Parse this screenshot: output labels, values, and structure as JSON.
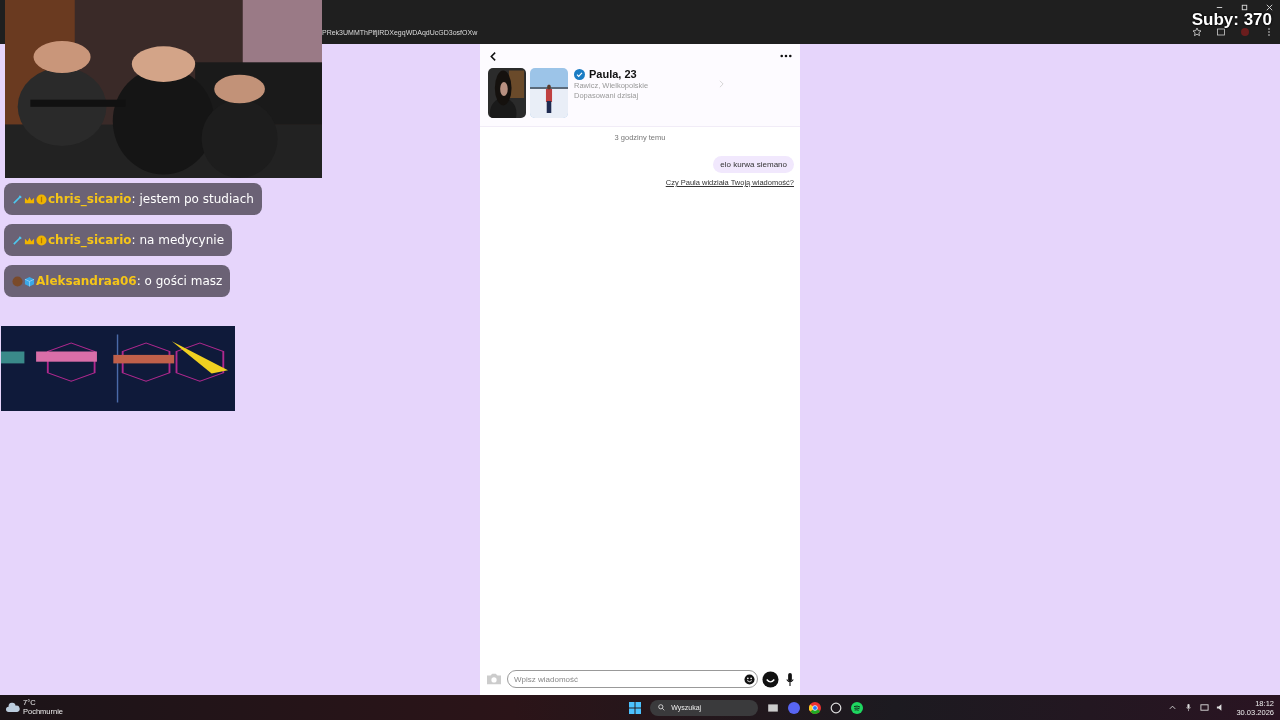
{
  "browser": {
    "url": "PRek3UMMThPlfjlRDXegqWDAqdUcGD3osfOXw"
  },
  "stream_overlay": {
    "subs": "Suby: 370",
    "chat": [
      {
        "user": "chris_sicario",
        "text": ": jestem po studiach",
        "kind": "vip"
      },
      {
        "user": "chris_sicario",
        "text": ": na medycynie",
        "kind": "vip"
      },
      {
        "user": "Aleksandraa06",
        "text": ": o gości masz",
        "kind": "viewer"
      }
    ]
  },
  "match": {
    "name": "Paula, 23",
    "verified": true,
    "location": "Rawicz, Wielkopolskie",
    "matched": "Dopasowani dzisiaj"
  },
  "conversation": {
    "time": "3 godziny temu",
    "messages": [
      {
        "text": "elo kurwa siemano",
        "kind": "outgoing"
      }
    ],
    "seen_prompt": "Czy Paula widziała Twoją wiadomość?"
  },
  "composer": {
    "placeholder": "Wpisz wiadomość"
  },
  "taskbar": {
    "temperature": "7°C",
    "weather": "Pochmurnie",
    "search_placeholder": "Wyszukaj",
    "time": "18:12",
    "date": "30.03.2026"
  }
}
